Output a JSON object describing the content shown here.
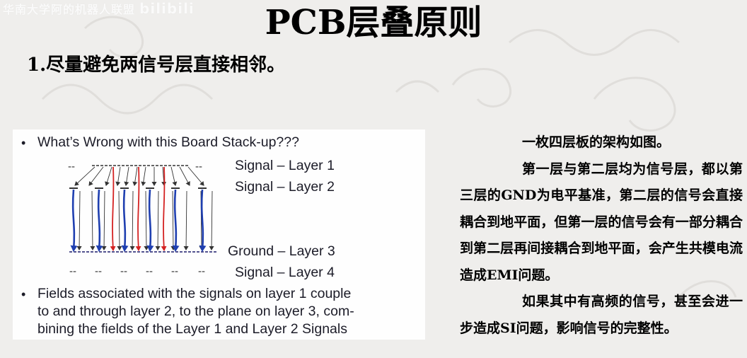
{
  "watermark": {
    "text": "华南大学阿的机器人联盟",
    "logo": "bilibili"
  },
  "title": "PCB层叠原则",
  "subtitle": "1.尽量避免两信号层直接相邻。",
  "figure": {
    "heading": "What’s Wrong with this Board Stack-up???",
    "layers": [
      {
        "label": "Signal – Layer 1"
      },
      {
        "label": "Signal – Layer 2"
      },
      {
        "label": "Ground – Layer 3"
      },
      {
        "label": "Signal – Layer 4"
      }
    ],
    "dash_text": "--",
    "bullet2_lines": [
      "Fields associated with the signals on layer 1 couple",
      "to and through layer 2, to the plane on layer 3, com-",
      "bining the fields of the Layer 1 and Layer 2 Signals"
    ],
    "colors": {
      "field_blue": "#1f3fb0",
      "field_red": "#d42222",
      "arrow_gray": "#333333"
    }
  },
  "paragraphs": [
    "一枚四层板的架构如图。",
    "第一层与第二层均为信号层，都以第三层的GND为电平基准，第二层的信号会直接耦合到地平面，但第一层的信号会有一部分耦合到第二层再间接耦合到地平面，会产生共模电流造成EMI问题。",
    "如果其中有高频的信号，甚至会进一步造成SI问题，影响信号的完整性。"
  ]
}
